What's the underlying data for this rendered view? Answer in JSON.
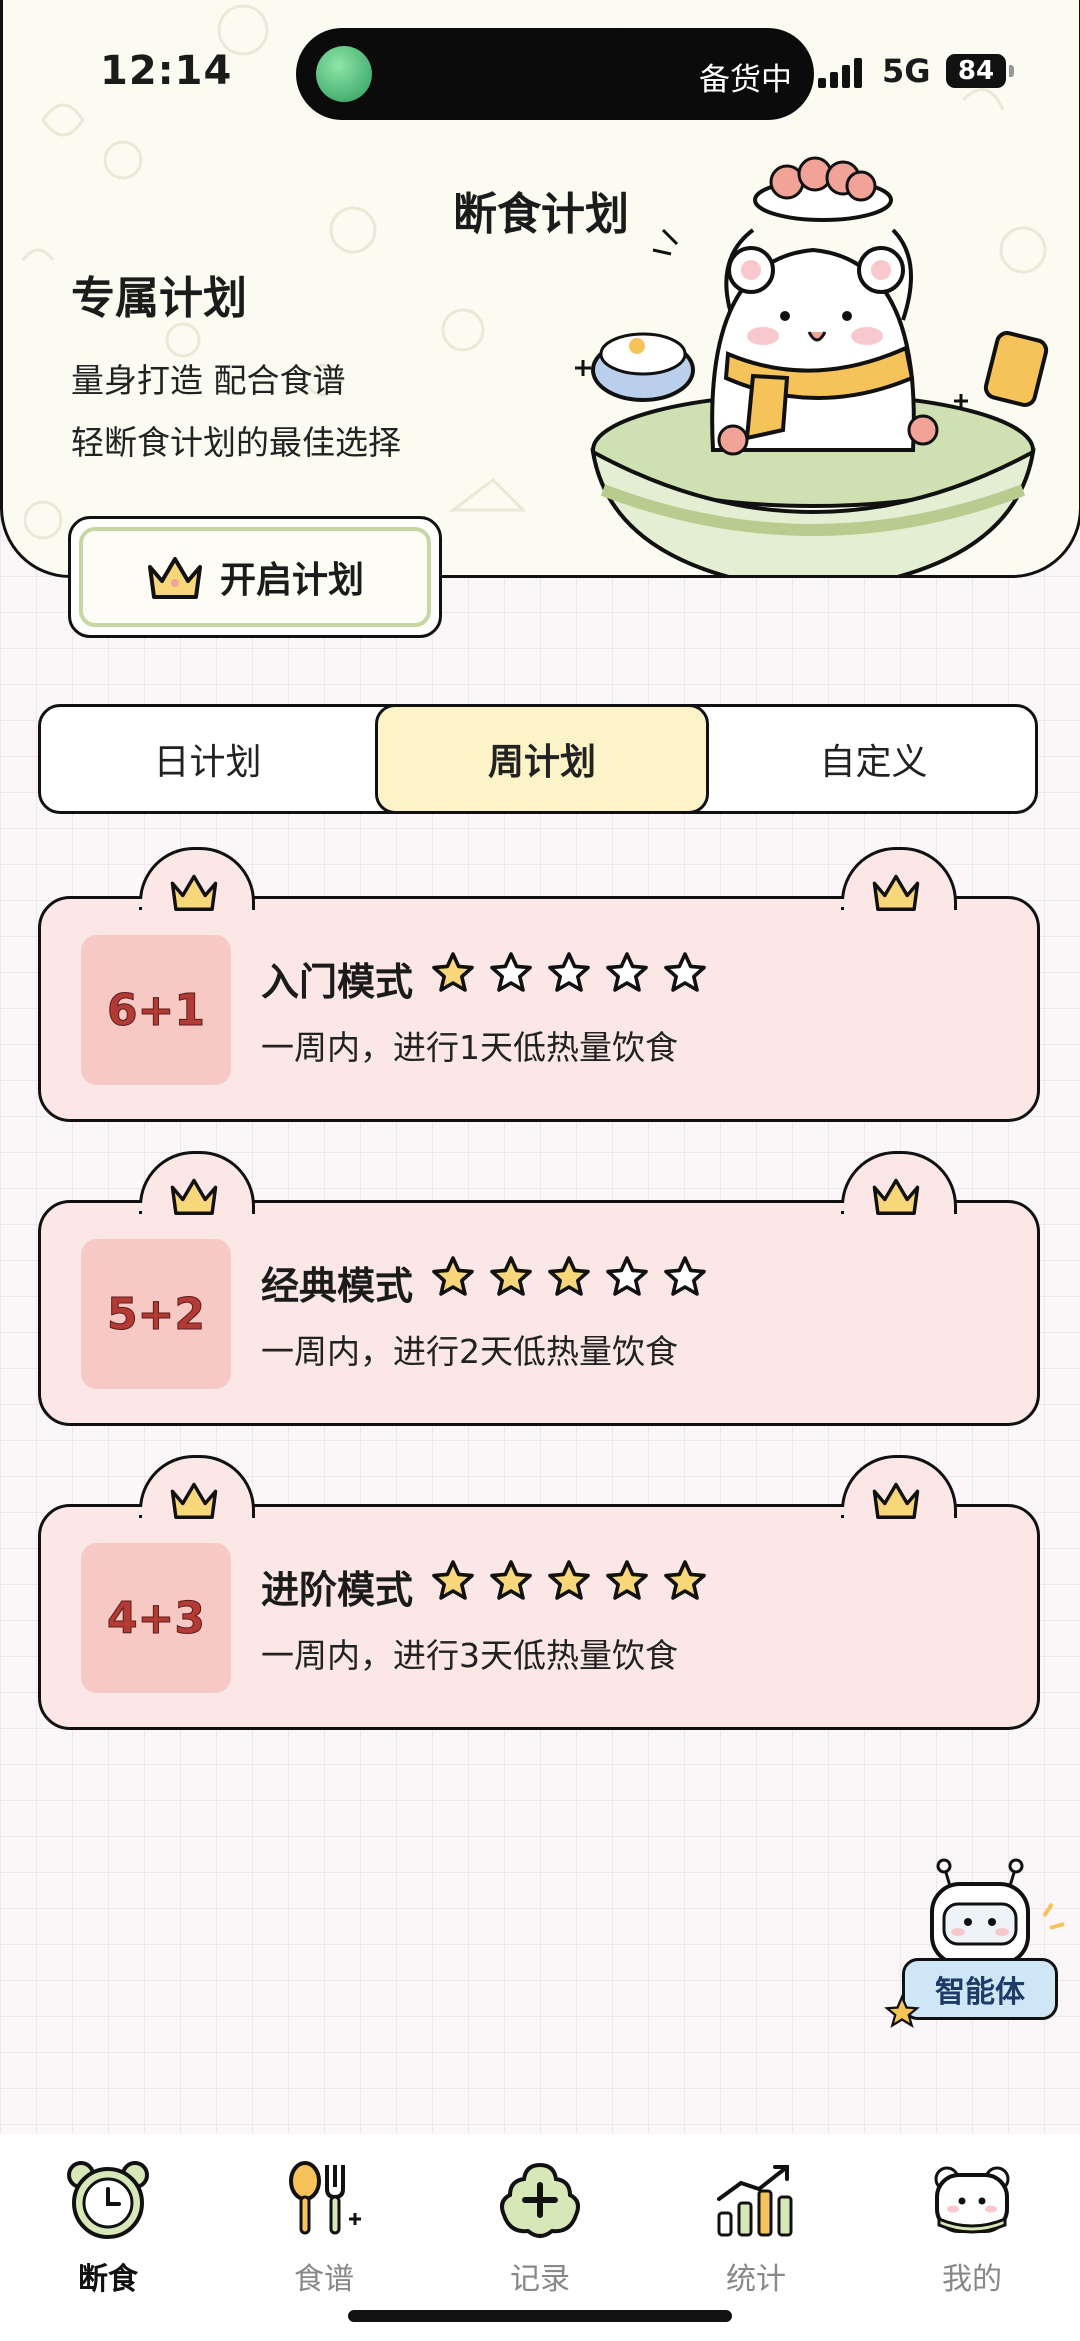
{
  "status_bar": {
    "time": "12:14",
    "island_text": "备货中",
    "network": "5G",
    "battery": "84"
  },
  "hero": {
    "title": "断食计划",
    "subtitle": "专属计划",
    "line1": "量身打造 配合食谱",
    "line2": "轻断食计划的最佳选择",
    "start_button": "开启计划"
  },
  "tabs": [
    {
      "label": "日计划",
      "selected": false
    },
    {
      "label": "周计划",
      "selected": true
    },
    {
      "label": "自定义",
      "selected": false
    }
  ],
  "plans": [
    {
      "badge": "6+1",
      "name": "入门模式",
      "stars": 1,
      "max_stars": 5,
      "desc": "一周内，进行1天低热量饮食"
    },
    {
      "badge": "5+2",
      "name": "经典模式",
      "stars": 3,
      "max_stars": 5,
      "desc": "一周内，进行2天低热量饮食"
    },
    {
      "badge": "4+3",
      "name": "进阶模式",
      "stars": 5,
      "max_stars": 5,
      "desc": "一周内，进行3天低热量饮食"
    }
  ],
  "assistant": {
    "label": "智能体"
  },
  "nav": [
    {
      "label": "断食",
      "icon": "clock-icon",
      "active": true
    },
    {
      "label": "食谱",
      "icon": "spoon-fork-icon",
      "active": false
    },
    {
      "label": "记录",
      "icon": "plus-record-icon",
      "active": false
    },
    {
      "label": "统计",
      "icon": "chart-icon",
      "active": false
    },
    {
      "label": "我的",
      "icon": "bear-face-icon",
      "active": false
    }
  ],
  "colors": {
    "card_bg": "#fbe7e6",
    "badge_bg": "#f6c9c4",
    "selected_tab": "#fdf3c9",
    "star_fill": "#f7d77a",
    "accent_green": "#c5d8a3"
  }
}
